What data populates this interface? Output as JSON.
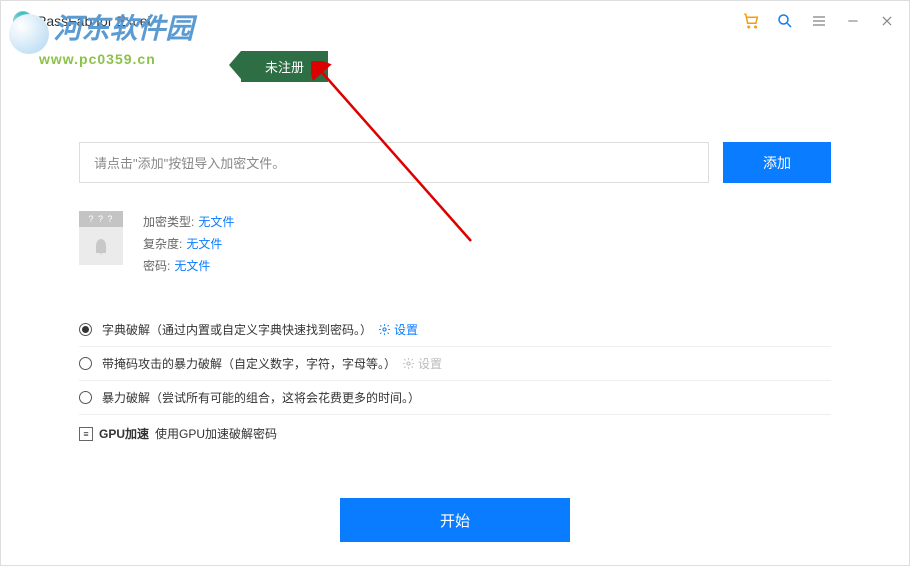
{
  "watermark": {
    "text": "河东软件园",
    "url": "www.pc0359.cn"
  },
  "app": {
    "title": "PassFab for Excel"
  },
  "badge": {
    "label": "未注册"
  },
  "input": {
    "placeholder": "请点击\"添加\"按钮导入加密文件。",
    "add_label": "添加"
  },
  "file": {
    "thumb_head": "? ? ?",
    "meta": [
      {
        "label": "加密类型:",
        "value": "无文件"
      },
      {
        "label": "复杂度:",
        "value": "无文件"
      },
      {
        "label": "密码:",
        "value": "无文件"
      }
    ]
  },
  "options": {
    "dict": "字典破解（通过内置或自定义字典快速找到密码。）",
    "mask": "带掩码攻击的暴力破解（自定义数字，字符，字母等。）",
    "brute": "暴力破解（尝试所有可能的组合，这将会花费更多的时间。）",
    "settings": "设置"
  },
  "gpu": {
    "label": "GPU加速",
    "desc": "使用GPU加速破解密码"
  },
  "start": {
    "label": "开始"
  }
}
